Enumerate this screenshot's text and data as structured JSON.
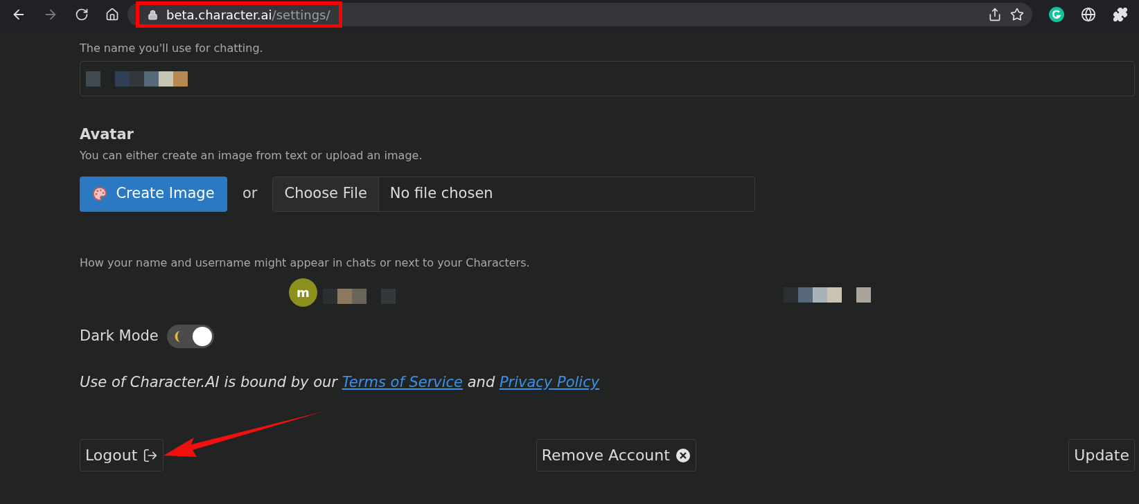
{
  "browser": {
    "url_host": "beta.character.ai",
    "url_path": "/settings/",
    "url_highlighted": true
  },
  "name_section": {
    "description": "The name you'll use for chatting."
  },
  "avatar_section": {
    "heading": "Avatar",
    "description": "You can either create an image from text or upload an image.",
    "create_button": "Create Image",
    "separator": "or",
    "file_button": "Choose File",
    "file_status": "No file chosen"
  },
  "preview": {
    "description": "How your name and username might appear in chats or next to your Characters.",
    "avatar_letter": "m"
  },
  "dark_mode": {
    "label": "Dark Mode",
    "on": true
  },
  "terms": {
    "text": "Use of Character.AI is bound by our",
    "link_terms": "Terms of Service",
    "joiner": "and",
    "link_privacy": "Privacy Policy"
  },
  "actions": [
    {
      "kind": "logout",
      "label": "Logout"
    },
    {
      "kind": "remove",
      "label": "Remove Account"
    },
    {
      "kind": "update",
      "label": "Update"
    }
  ],
  "annotation": {
    "arrow_to_logout": true
  }
}
